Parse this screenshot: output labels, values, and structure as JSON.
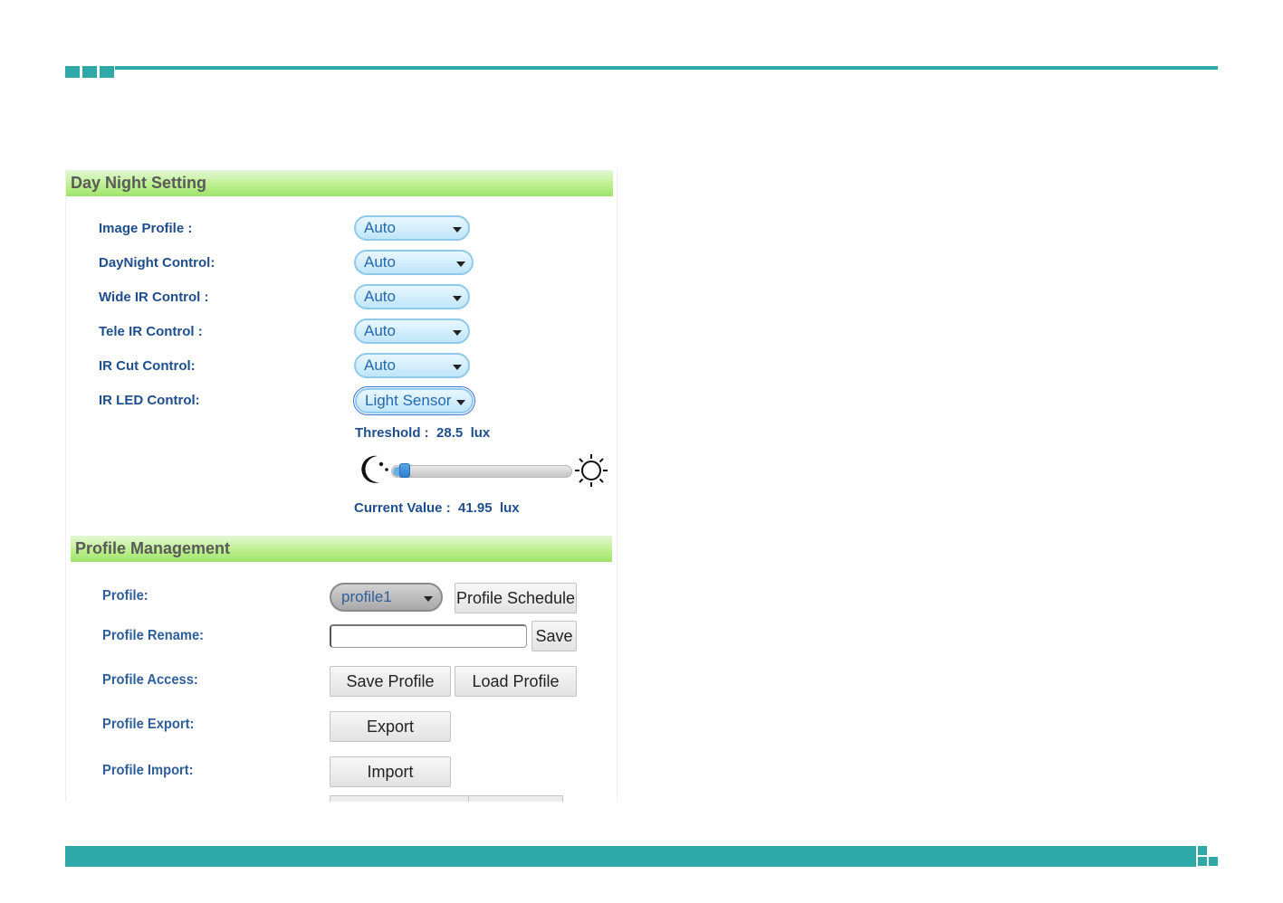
{
  "colors": {
    "accent": "#2fa8a8",
    "header_green": "#bdf08f",
    "label_blue": "#1f4e8c",
    "select_text": "#2767ac"
  },
  "day_night": {
    "title": "Day Night Setting",
    "rows": [
      {
        "label": "Image Profile :",
        "value": "Auto"
      },
      {
        "label": "DayNight Control:",
        "value": "Auto"
      },
      {
        "label": "Wide IR Control :",
        "value": "Auto"
      },
      {
        "label": "Tele IR Control :",
        "value": "Auto"
      },
      {
        "label": "IR Cut Control:",
        "value": "Auto"
      },
      {
        "label": "IR LED Control:",
        "value": "Light Sensor"
      }
    ],
    "threshold": {
      "label": "Threshold :",
      "value": "28.5",
      "unit": "lux"
    },
    "slider": {
      "level_fraction": 0.05,
      "left_icon": "moon-icon",
      "right_icon": "sun-icon"
    },
    "current": {
      "label": "Current Value :",
      "value": "41.95",
      "unit": "lux"
    }
  },
  "profile_mgmt": {
    "title": "Profile Management",
    "profile": {
      "label": "Profile:",
      "value": "profile1",
      "schedule_button": "Profile Schedule"
    },
    "rename": {
      "label": "Profile Rename:",
      "input_value": "",
      "save_button": "Save"
    },
    "access": {
      "label": "Profile Access:",
      "save_button": "Save Profile",
      "load_button": "Load Profile"
    },
    "export": {
      "label": "Profile Export:",
      "button": "Export"
    },
    "import": {
      "label": "Profile Import:",
      "button": "Import"
    }
  }
}
